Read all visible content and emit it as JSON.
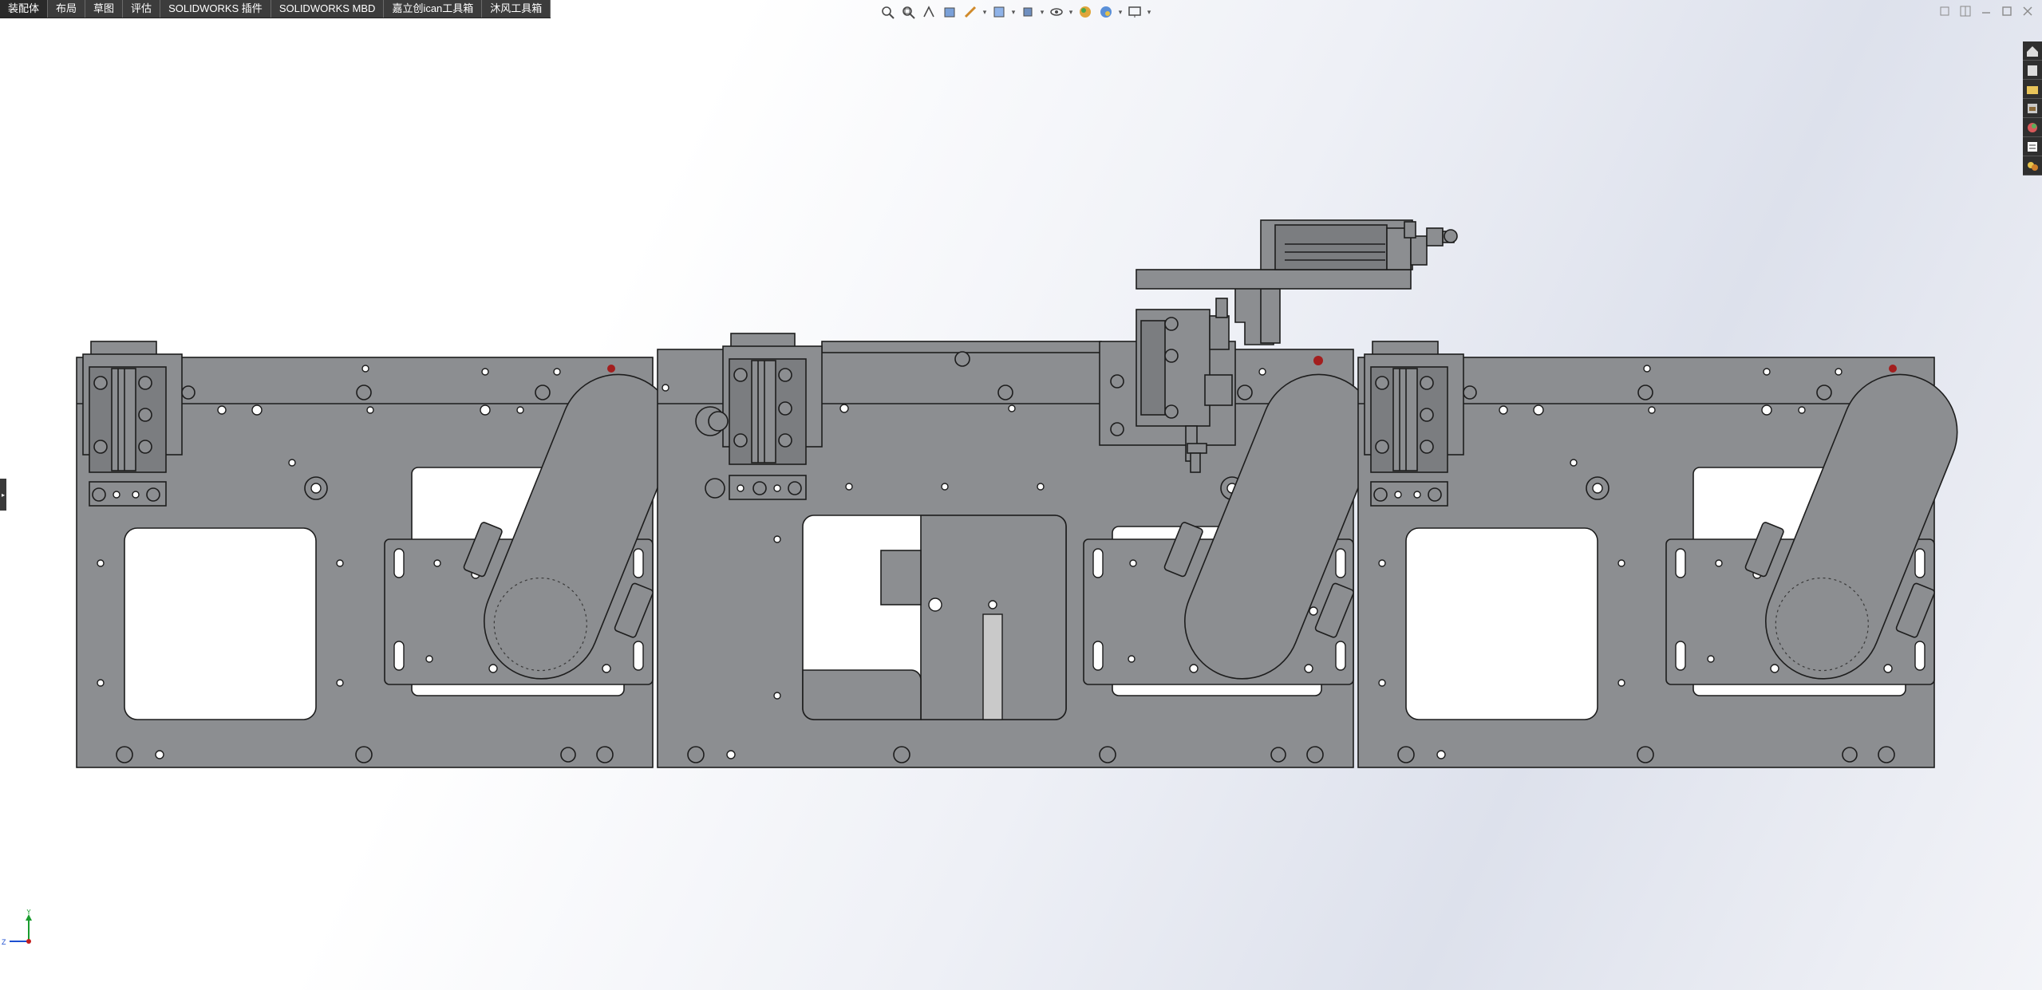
{
  "tabs": [
    "装配体",
    "布局",
    "草图",
    "评估",
    "SOLIDWORKS 插件",
    "SOLIDWORKS MBD",
    "嘉立创ican工具箱",
    "沐风工具箱"
  ],
  "hud_icons": [
    "zoom-to-fit-icon",
    "zoom-to-area-icon",
    "previous-view-icon",
    "section-view-icon",
    "dynamic-annotation-icon",
    "view-orientation-icon",
    "display-style-icon",
    "hide-show-items-icon",
    "edit-appearance-icon",
    "apply-scene-icon",
    "view-settings-icon"
  ],
  "window_controls": [
    "restore-down-icon",
    "tile-icon",
    "minimize-icon",
    "maximize-icon",
    "close-icon"
  ],
  "taskpane_icons": [
    "solidworks-resources-icon",
    "design-library-icon",
    "file-explorer-icon",
    "view-palette-icon",
    "appearances-icon",
    "custom-properties-icon",
    "solidworks-forum-icon"
  ],
  "colors": {
    "part_fill": "#8c8e91",
    "part_stroke": "#1d1d1d",
    "hole_fill": "#ffffff",
    "tab_bar": "#3c3c3c",
    "taskpane": "#2f2f2f"
  },
  "triad": {
    "y_label": "Y",
    "z_label": "Z"
  }
}
